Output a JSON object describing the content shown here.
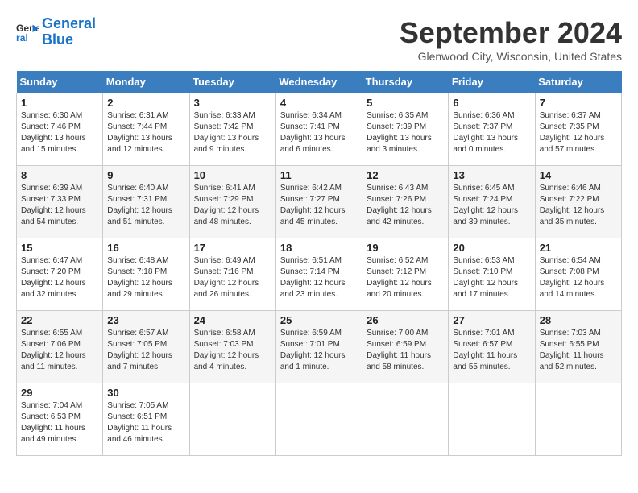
{
  "header": {
    "logo_line1": "General",
    "logo_line2": "Blue",
    "month": "September 2024",
    "location": "Glenwood City, Wisconsin, United States"
  },
  "days_of_week": [
    "Sunday",
    "Monday",
    "Tuesday",
    "Wednesday",
    "Thursday",
    "Friday",
    "Saturday"
  ],
  "weeks": [
    [
      {
        "day": "1",
        "info": "Sunrise: 6:30 AM\nSunset: 7:46 PM\nDaylight: 13 hours\nand 15 minutes."
      },
      {
        "day": "2",
        "info": "Sunrise: 6:31 AM\nSunset: 7:44 PM\nDaylight: 13 hours\nand 12 minutes."
      },
      {
        "day": "3",
        "info": "Sunrise: 6:33 AM\nSunset: 7:42 PM\nDaylight: 13 hours\nand 9 minutes."
      },
      {
        "day": "4",
        "info": "Sunrise: 6:34 AM\nSunset: 7:41 PM\nDaylight: 13 hours\nand 6 minutes."
      },
      {
        "day": "5",
        "info": "Sunrise: 6:35 AM\nSunset: 7:39 PM\nDaylight: 13 hours\nand 3 minutes."
      },
      {
        "day": "6",
        "info": "Sunrise: 6:36 AM\nSunset: 7:37 PM\nDaylight: 13 hours\nand 0 minutes."
      },
      {
        "day": "7",
        "info": "Sunrise: 6:37 AM\nSunset: 7:35 PM\nDaylight: 12 hours\nand 57 minutes."
      }
    ],
    [
      {
        "day": "8",
        "info": "Sunrise: 6:39 AM\nSunset: 7:33 PM\nDaylight: 12 hours\nand 54 minutes."
      },
      {
        "day": "9",
        "info": "Sunrise: 6:40 AM\nSunset: 7:31 PM\nDaylight: 12 hours\nand 51 minutes."
      },
      {
        "day": "10",
        "info": "Sunrise: 6:41 AM\nSunset: 7:29 PM\nDaylight: 12 hours\nand 48 minutes."
      },
      {
        "day": "11",
        "info": "Sunrise: 6:42 AM\nSunset: 7:27 PM\nDaylight: 12 hours\nand 45 minutes."
      },
      {
        "day": "12",
        "info": "Sunrise: 6:43 AM\nSunset: 7:26 PM\nDaylight: 12 hours\nand 42 minutes."
      },
      {
        "day": "13",
        "info": "Sunrise: 6:45 AM\nSunset: 7:24 PM\nDaylight: 12 hours\nand 39 minutes."
      },
      {
        "day": "14",
        "info": "Sunrise: 6:46 AM\nSunset: 7:22 PM\nDaylight: 12 hours\nand 35 minutes."
      }
    ],
    [
      {
        "day": "15",
        "info": "Sunrise: 6:47 AM\nSunset: 7:20 PM\nDaylight: 12 hours\nand 32 minutes."
      },
      {
        "day": "16",
        "info": "Sunrise: 6:48 AM\nSunset: 7:18 PM\nDaylight: 12 hours\nand 29 minutes."
      },
      {
        "day": "17",
        "info": "Sunrise: 6:49 AM\nSunset: 7:16 PM\nDaylight: 12 hours\nand 26 minutes."
      },
      {
        "day": "18",
        "info": "Sunrise: 6:51 AM\nSunset: 7:14 PM\nDaylight: 12 hours\nand 23 minutes."
      },
      {
        "day": "19",
        "info": "Sunrise: 6:52 AM\nSunset: 7:12 PM\nDaylight: 12 hours\nand 20 minutes."
      },
      {
        "day": "20",
        "info": "Sunrise: 6:53 AM\nSunset: 7:10 PM\nDaylight: 12 hours\nand 17 minutes."
      },
      {
        "day": "21",
        "info": "Sunrise: 6:54 AM\nSunset: 7:08 PM\nDaylight: 12 hours\nand 14 minutes."
      }
    ],
    [
      {
        "day": "22",
        "info": "Sunrise: 6:55 AM\nSunset: 7:06 PM\nDaylight: 12 hours\nand 11 minutes."
      },
      {
        "day": "23",
        "info": "Sunrise: 6:57 AM\nSunset: 7:05 PM\nDaylight: 12 hours\nand 7 minutes."
      },
      {
        "day": "24",
        "info": "Sunrise: 6:58 AM\nSunset: 7:03 PM\nDaylight: 12 hours\nand 4 minutes."
      },
      {
        "day": "25",
        "info": "Sunrise: 6:59 AM\nSunset: 7:01 PM\nDaylight: 12 hours\nand 1 minute."
      },
      {
        "day": "26",
        "info": "Sunrise: 7:00 AM\nSunset: 6:59 PM\nDaylight: 11 hours\nand 58 minutes."
      },
      {
        "day": "27",
        "info": "Sunrise: 7:01 AM\nSunset: 6:57 PM\nDaylight: 11 hours\nand 55 minutes."
      },
      {
        "day": "28",
        "info": "Sunrise: 7:03 AM\nSunset: 6:55 PM\nDaylight: 11 hours\nand 52 minutes."
      }
    ],
    [
      {
        "day": "29",
        "info": "Sunrise: 7:04 AM\nSunset: 6:53 PM\nDaylight: 11 hours\nand 49 minutes."
      },
      {
        "day": "30",
        "info": "Sunrise: 7:05 AM\nSunset: 6:51 PM\nDaylight: 11 hours\nand 46 minutes."
      },
      {
        "day": "",
        "info": ""
      },
      {
        "day": "",
        "info": ""
      },
      {
        "day": "",
        "info": ""
      },
      {
        "day": "",
        "info": ""
      },
      {
        "day": "",
        "info": ""
      }
    ]
  ]
}
